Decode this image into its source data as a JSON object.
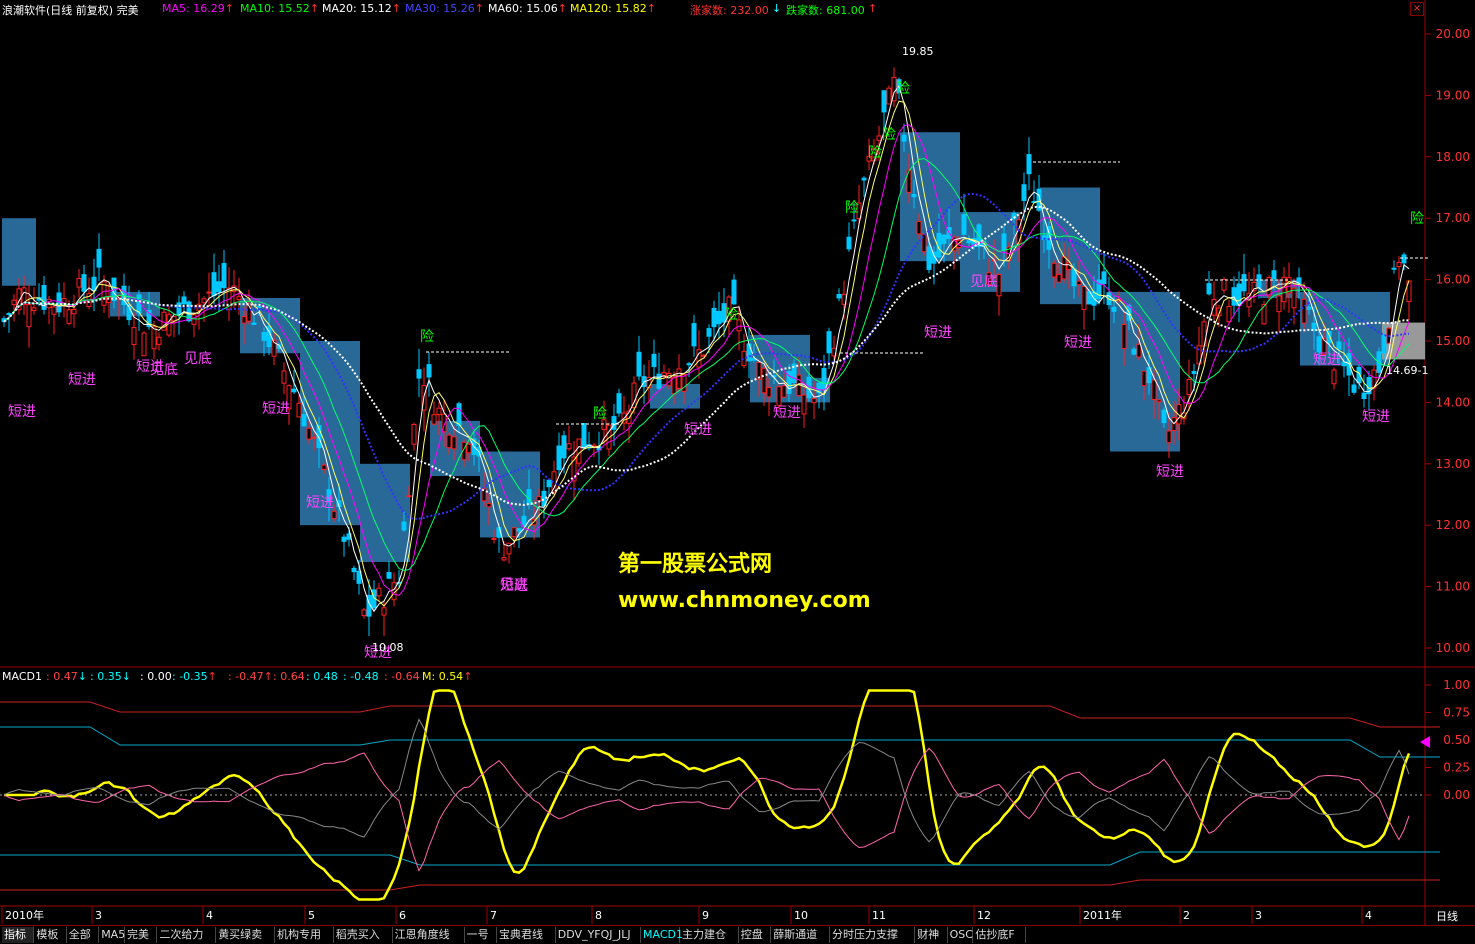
{
  "header": {
    "title": "浪潮软件(日线 前复权) 完美",
    "ma_items": [
      {
        "label": "MA5: 16.29",
        "arrow": "↑",
        "color": "#ff00ff"
      },
      {
        "label": "MA10: 15.52",
        "arrow": "↑",
        "color": "#00ff00"
      },
      {
        "label": "MA20: 15.12",
        "arrow": "↑",
        "color": "#ffffff"
      },
      {
        "label": "MA30: 15.26",
        "arrow": "↑",
        "color": "#4444ff"
      },
      {
        "label": "MA60: 15.06",
        "arrow": "↑",
        "color": "#ffffff"
      },
      {
        "label": "MA120: 15.82",
        "arrow": "↑",
        "color": "#ffff00"
      }
    ],
    "up_count": "涨家数: 232.00",
    "down_count": "跌家数: 681.00",
    "close": "×"
  },
  "price_axis": [
    "20.00",
    "19.00",
    "18.00",
    "17.00",
    "16.00",
    "15.00",
    "14.00",
    "13.00",
    "12.00",
    "11.00",
    "10.00"
  ],
  "annotations": {
    "high": "19.85",
    "low": "10.08",
    "last": "14.69-1"
  },
  "signal_labels": {
    "short_entry": "短进",
    "bottom": "见底",
    "risk": "险"
  },
  "macd_header": {
    "name": "MACD1",
    "values": [
      {
        "text": ": 0.47",
        "arrow": "↓",
        "color": "#ff4444"
      },
      {
        "text": ": 0.35",
        "arrow": "↓",
        "color": "#00ffff"
      },
      {
        "text": ": 0.00",
        "arrow": "",
        "color": "#ffffff"
      },
      {
        "text": ": -0.35",
        "arrow": "↑",
        "color": "#00ffff"
      },
      {
        "text": ": -0.47",
        "arrow": "↑",
        "color": "#ff4444"
      },
      {
        "text": ": 0.64",
        "arrow": "",
        "color": "#ff4444"
      },
      {
        "text": ": 0.48",
        "arrow": "",
        "color": "#00ffff"
      },
      {
        "text": ": -0.48",
        "arrow": "",
        "color": "#00ffff"
      },
      {
        "text": ": -0.64",
        "arrow": "",
        "color": "#ff4444"
      },
      {
        "text": "M: 0.54",
        "arrow": "↑",
        "color": "#ffff00"
      }
    ]
  },
  "macd_axis": [
    "1.00",
    "0.75",
    "0.50",
    "0.25",
    "0.00"
  ],
  "time_axis": [
    "2010年",
    "3",
    "4",
    "5",
    "6",
    "7",
    "8",
    "9",
    "10",
    "11",
    "12",
    "2011年",
    "2",
    "3",
    "4"
  ],
  "period": "日线",
  "watermark": {
    "line1": "第一股票公式网",
    "line2": "www.chnmoney.com"
  },
  "tabs": [
    "指标",
    "模板",
    "全部",
    "MA5",
    "完美",
    "二次给力",
    "黄买绿卖",
    "机构专用",
    "稻壳买入",
    "江恩角度线",
    "一号",
    "宝典君线",
    "DDV_YFQJ_JLJ",
    "MACD1",
    "主力建仓",
    "控盘",
    "薛斯通道",
    "分时压力支撑",
    "财神",
    "OSC",
    "估抄底F"
  ],
  "active_tab": "指标",
  "chart_data": {
    "type": "line",
    "title": "浪潮软件(日线 前复权) 完美",
    "ylim": [
      10.0,
      20.0
    ],
    "x": [
      "2010年",
      "3",
      "4",
      "5",
      "6",
      "7",
      "8",
      "9",
      "10",
      "11",
      "12",
      "2011年",
      "2",
      "3",
      "4"
    ],
    "series": [
      {
        "name": "close",
        "values": [
          15.0,
          15.7,
          15.1,
          13.3,
          11.2,
          12.6,
          13.4,
          14.8,
          14.5,
          18.6,
          17.3,
          15.2,
          15.8,
          14.4,
          16.3
        ]
      },
      {
        "name": "MA30",
        "values": [
          14.0,
          14.4,
          14.8,
          14.6,
          13.6,
          13.7,
          13.9,
          13.6,
          13.7,
          14.8,
          15.3,
          15.1,
          15.4,
          15.3,
          15.3
        ]
      },
      {
        "name": "MA60",
        "values": [
          15.2,
          15.3,
          15.4,
          14.8,
          13.8,
          12.9,
          12.6,
          12.8,
          13.6,
          15.0,
          16.4,
          16.2,
          15.8,
          15.4,
          15.1
        ]
      }
    ],
    "macd": {
      "ylim": [
        -1.0,
        1.0
      ],
      "series": [
        {
          "name": "M",
          "values": [
            0.1,
            0.3,
            0.0,
            -0.5,
            0.75,
            -0.3,
            0.3,
            0.35,
            -0.2,
            0.95,
            -0.2,
            0.25,
            0.5,
            -0.35,
            0.54
          ]
        }
      ]
    }
  }
}
